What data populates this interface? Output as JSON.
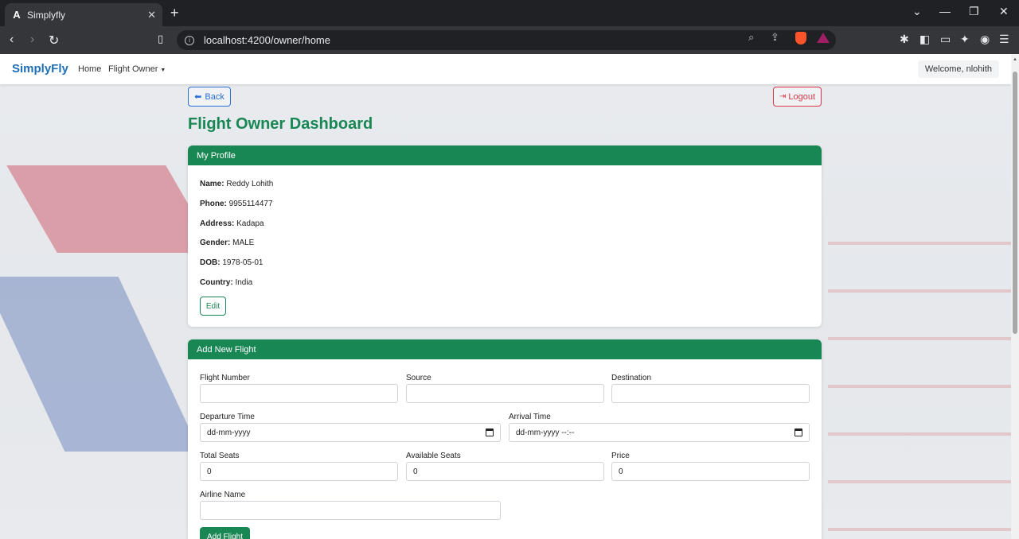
{
  "browser": {
    "tab_title": "Simplyfly",
    "tab_favicon": "A",
    "url": "localhost:4200/owner/home"
  },
  "navbar": {
    "brand": "SimplyFly",
    "links": [
      "Home",
      "Flight Owner"
    ],
    "welcome": "Welcome, nlohith"
  },
  "actions": {
    "back": "Back",
    "logout": "Logout"
  },
  "page_title": "Flight Owner Dashboard",
  "profile": {
    "header": "My Profile",
    "fields": [
      {
        "label": "Name:",
        "value": "Reddy Lohith"
      },
      {
        "label": "Phone:",
        "value": "9955114477"
      },
      {
        "label": "Address:",
        "value": "Kadapa"
      },
      {
        "label": "Gender:",
        "value": "MALE"
      },
      {
        "label": "DOB:",
        "value": "1978-05-01"
      },
      {
        "label": "Country:",
        "value": "India"
      }
    ],
    "edit_label": "Edit"
  },
  "add_flight": {
    "header": "Add New Flight",
    "flight_number_label": "Flight Number",
    "source_label": "Source",
    "destination_label": "Destination",
    "departure_label": "Departure Time",
    "departure_value": "dd-mm-yyyy",
    "arrival_label": "Arrival Time",
    "arrival_value": "dd-mm-yyyy --:--",
    "total_seats_label": "Total Seats",
    "total_seats_value": "0",
    "available_seats_label": "Available Seats",
    "available_seats_value": "0",
    "price_label": "Price",
    "price_value": "0",
    "airline_label": "Airline Name",
    "submit_label": "Add Flight"
  },
  "colors": {
    "primary_green": "#198754",
    "brand_blue": "#1f6fb8",
    "logout_red": "#dc3545"
  }
}
